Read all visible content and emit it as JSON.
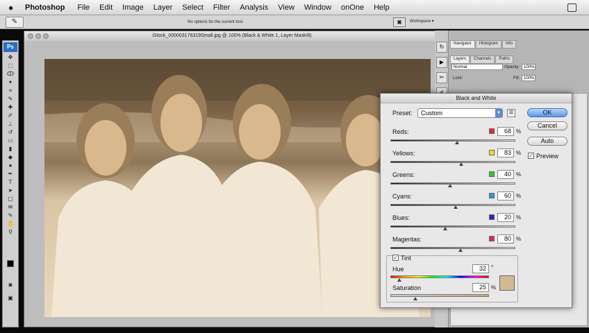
{
  "menubar": {
    "app_name": "Photoshop",
    "items": [
      "File",
      "Edit",
      "Image",
      "Layer",
      "Select",
      "Filter",
      "Analysis",
      "View",
      "Window",
      "onOne",
      "Help"
    ]
  },
  "options": {
    "text": "No options for the current tool.",
    "workspace": "Workspace ▾"
  },
  "document": {
    "title": "iStock_000003176319Small.jpg @ 100% (Black & White 1, Layer Mask/8)"
  },
  "panels": {
    "top_tabs": [
      "Navigator",
      "Histogram",
      "Info"
    ],
    "layer_tabs": [
      "Layers",
      "Channels",
      "Paths"
    ],
    "blend_mode": "Normal",
    "opacity_label": "Opacity:",
    "opacity_value": "100%",
    "lock_label": "Lock:",
    "fill_label": "Fill:",
    "fill_value": "100%"
  },
  "dialog": {
    "title": "Black and White",
    "preset_label": "Preset:",
    "preset_value": "Custom",
    "buttons": {
      "ok": "OK",
      "cancel": "Cancel",
      "auto": "Auto"
    },
    "preview_label": "Preview",
    "preview_checked": true,
    "percent": "%",
    "channels": [
      {
        "label": "Reds:",
        "value": "68",
        "color": "#e8262a"
      },
      {
        "label": "Yellows:",
        "value": "83",
        "color": "#ece41a"
      },
      {
        "label": "Greens:",
        "value": "40",
        "color": "#2fc92c"
      },
      {
        "label": "Cyans:",
        "value": "60",
        "color": "#2a9ad6"
      },
      {
        "label": "Blues:",
        "value": "20",
        "color": "#2a20c8"
      },
      {
        "label": "Magentas:",
        "value": "80",
        "color": "#d82471"
      }
    ],
    "tint": {
      "label": "Tint",
      "checked": true,
      "hue_label": "Hue",
      "hue_value": "32",
      "hue_unit": "°",
      "saturation_label": "Saturation",
      "saturation_value": "25",
      "saturation_unit": "%",
      "color": "#d3b894"
    }
  },
  "colors": {
    "accent": "#5b97e4",
    "ps_logo": "#2a6fbf"
  }
}
